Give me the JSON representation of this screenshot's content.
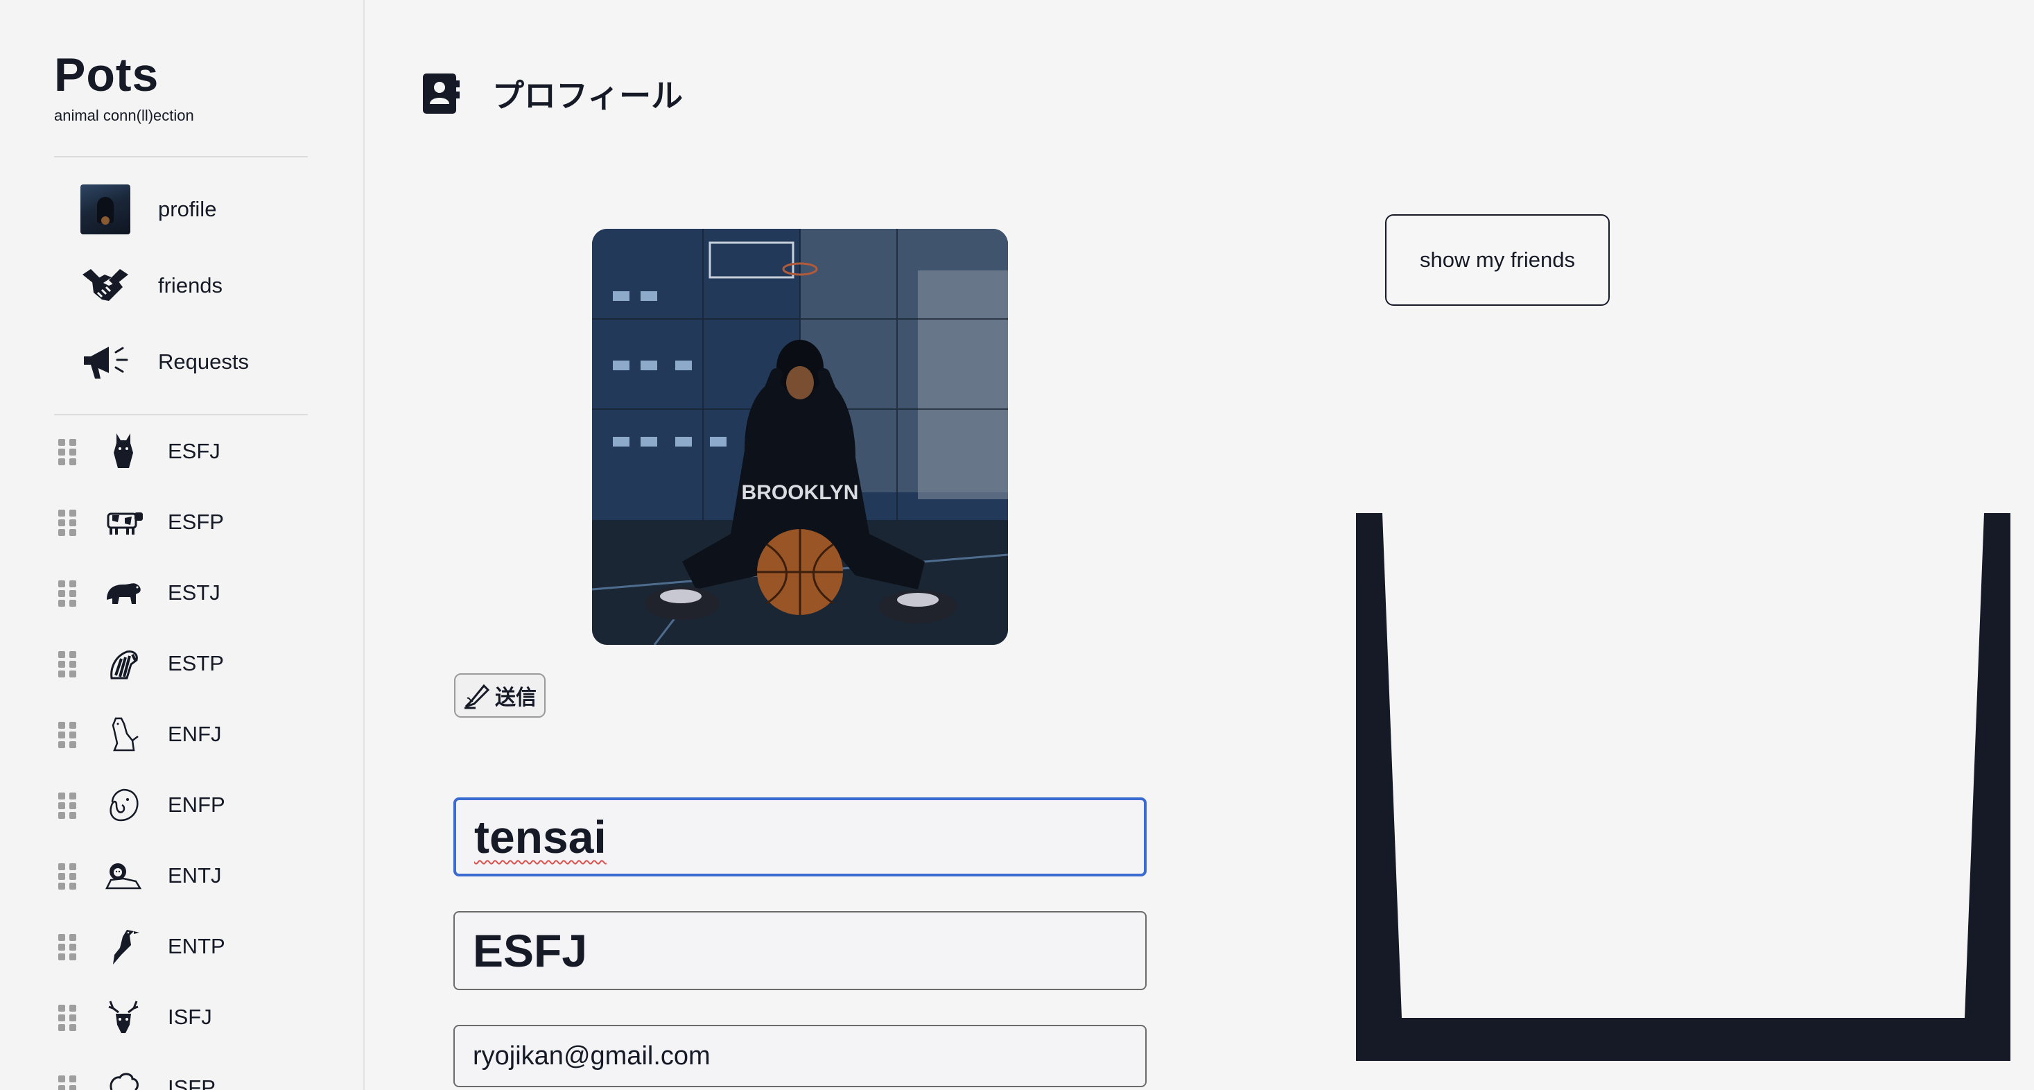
{
  "sidebar": {
    "brand": {
      "title": "Pots",
      "subtitle": "animal conn(ll)ection"
    },
    "nav": [
      {
        "label": "profile",
        "icon": "avatar-thumbnail"
      },
      {
        "label": "friends",
        "icon": "handshake-icon"
      },
      {
        "label": "Requests",
        "icon": "megaphone-icon"
      }
    ],
    "types": [
      {
        "label": "ESFJ",
        "icon": "horse-head-icon"
      },
      {
        "label": "ESFP",
        "icon": "cow-icon"
      },
      {
        "label": "ESTJ",
        "icon": "bear-icon"
      },
      {
        "label": "ESTP",
        "icon": "zebra-icon"
      },
      {
        "label": "ENFJ",
        "icon": "dog-icon"
      },
      {
        "label": "ENFP",
        "icon": "elephant-icon"
      },
      {
        "label": "ENTJ",
        "icon": "lion-icon"
      },
      {
        "label": "ENTP",
        "icon": "bird-icon"
      },
      {
        "label": "ISFJ",
        "icon": "deer-icon"
      },
      {
        "label": "ISFP",
        "icon": "sheep-icon"
      }
    ]
  },
  "main": {
    "header": {
      "title": "プロフィール",
      "icon": "contact-book-icon"
    },
    "send_button": {
      "label": "送信",
      "icon": "pen-writing-icon"
    },
    "fields": {
      "name": "tensai",
      "type": "ESFJ",
      "email": "ryojikan@gmail.com"
    },
    "friends_button": {
      "label": "show my friends"
    }
  },
  "colors": {
    "background": "#f5f5f5",
    "text": "#151a26",
    "focus_border": "#3a6bd1",
    "cup": "#151a26"
  }
}
